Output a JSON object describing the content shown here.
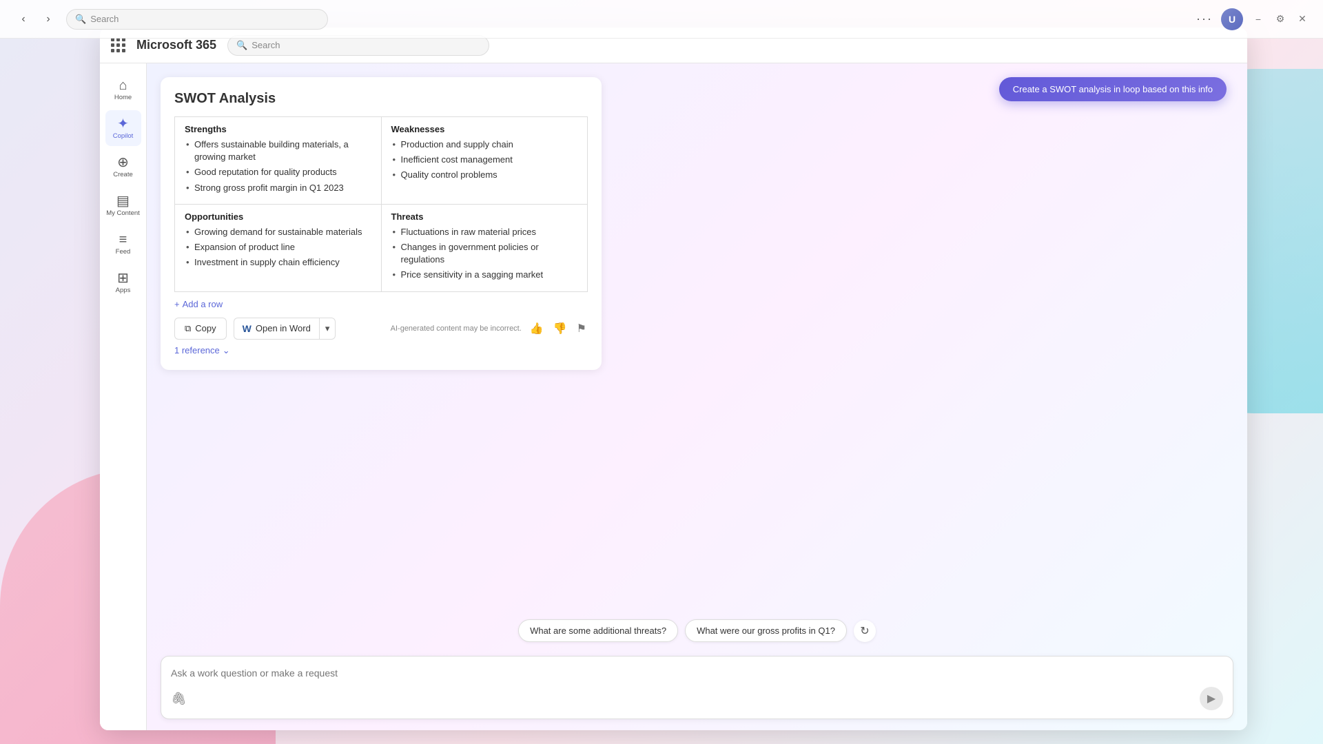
{
  "browser": {
    "search_placeholder": "Search",
    "dots_label": "···",
    "avatar_initials": "U",
    "minimize_icon": "−",
    "settings_icon": "⚙",
    "close_icon": "✕"
  },
  "app": {
    "title": "Microsoft 365",
    "search_placeholder": "Search"
  },
  "sidebar": {
    "items": [
      {
        "id": "home",
        "label": "Home",
        "icon": "⌂",
        "active": false
      },
      {
        "id": "copilot",
        "label": "Copilot",
        "icon": "✦",
        "active": true
      },
      {
        "id": "create",
        "label": "Create",
        "icon": "⊕",
        "active": false
      },
      {
        "id": "my-content",
        "label": "My Content",
        "icon": "▤",
        "active": false
      },
      {
        "id": "feed",
        "label": "Feed",
        "icon": "≡",
        "active": false
      },
      {
        "id": "apps",
        "label": "Apps",
        "icon": "⊞",
        "active": false
      }
    ]
  },
  "copilot_btn": {
    "label": "Create a SWOT analysis in loop based on this info"
  },
  "swot": {
    "title": "SWOT Analysis",
    "strengths_header": "Strengths",
    "strengths_items": [
      "Offers sustainable building materials, a growing market",
      "Good reputation for quality products",
      "Strong gross profit margin in Q1 2023"
    ],
    "weaknesses_header": "Weaknesses",
    "weaknesses_items": [
      "Production and supply chain",
      "Inefficient cost management",
      "Quality control problems"
    ],
    "opportunities_header": "Opportunities",
    "opportunities_items": [
      "Growing demand for sustainable materials",
      "Expansion of product line",
      "Investment in supply chain efficiency"
    ],
    "threats_header": "Threats",
    "threats_items": [
      "Fluctuations in raw material prices",
      "Changes in government policies or regulations",
      "Price sensitivity in a sagging market"
    ],
    "add_row_label": "+ Add a row"
  },
  "actions": {
    "copy_label": "Copy",
    "open_word_label": "Open in Word",
    "ai_notice": "AI-generated content may be incorrect.",
    "reference_label": "1 reference"
  },
  "suggestions": {
    "chips": [
      "What are some additional threats?",
      "What were our gross profits in Q1?"
    ]
  },
  "input": {
    "placeholder": "Ask a work question or make a request"
  }
}
